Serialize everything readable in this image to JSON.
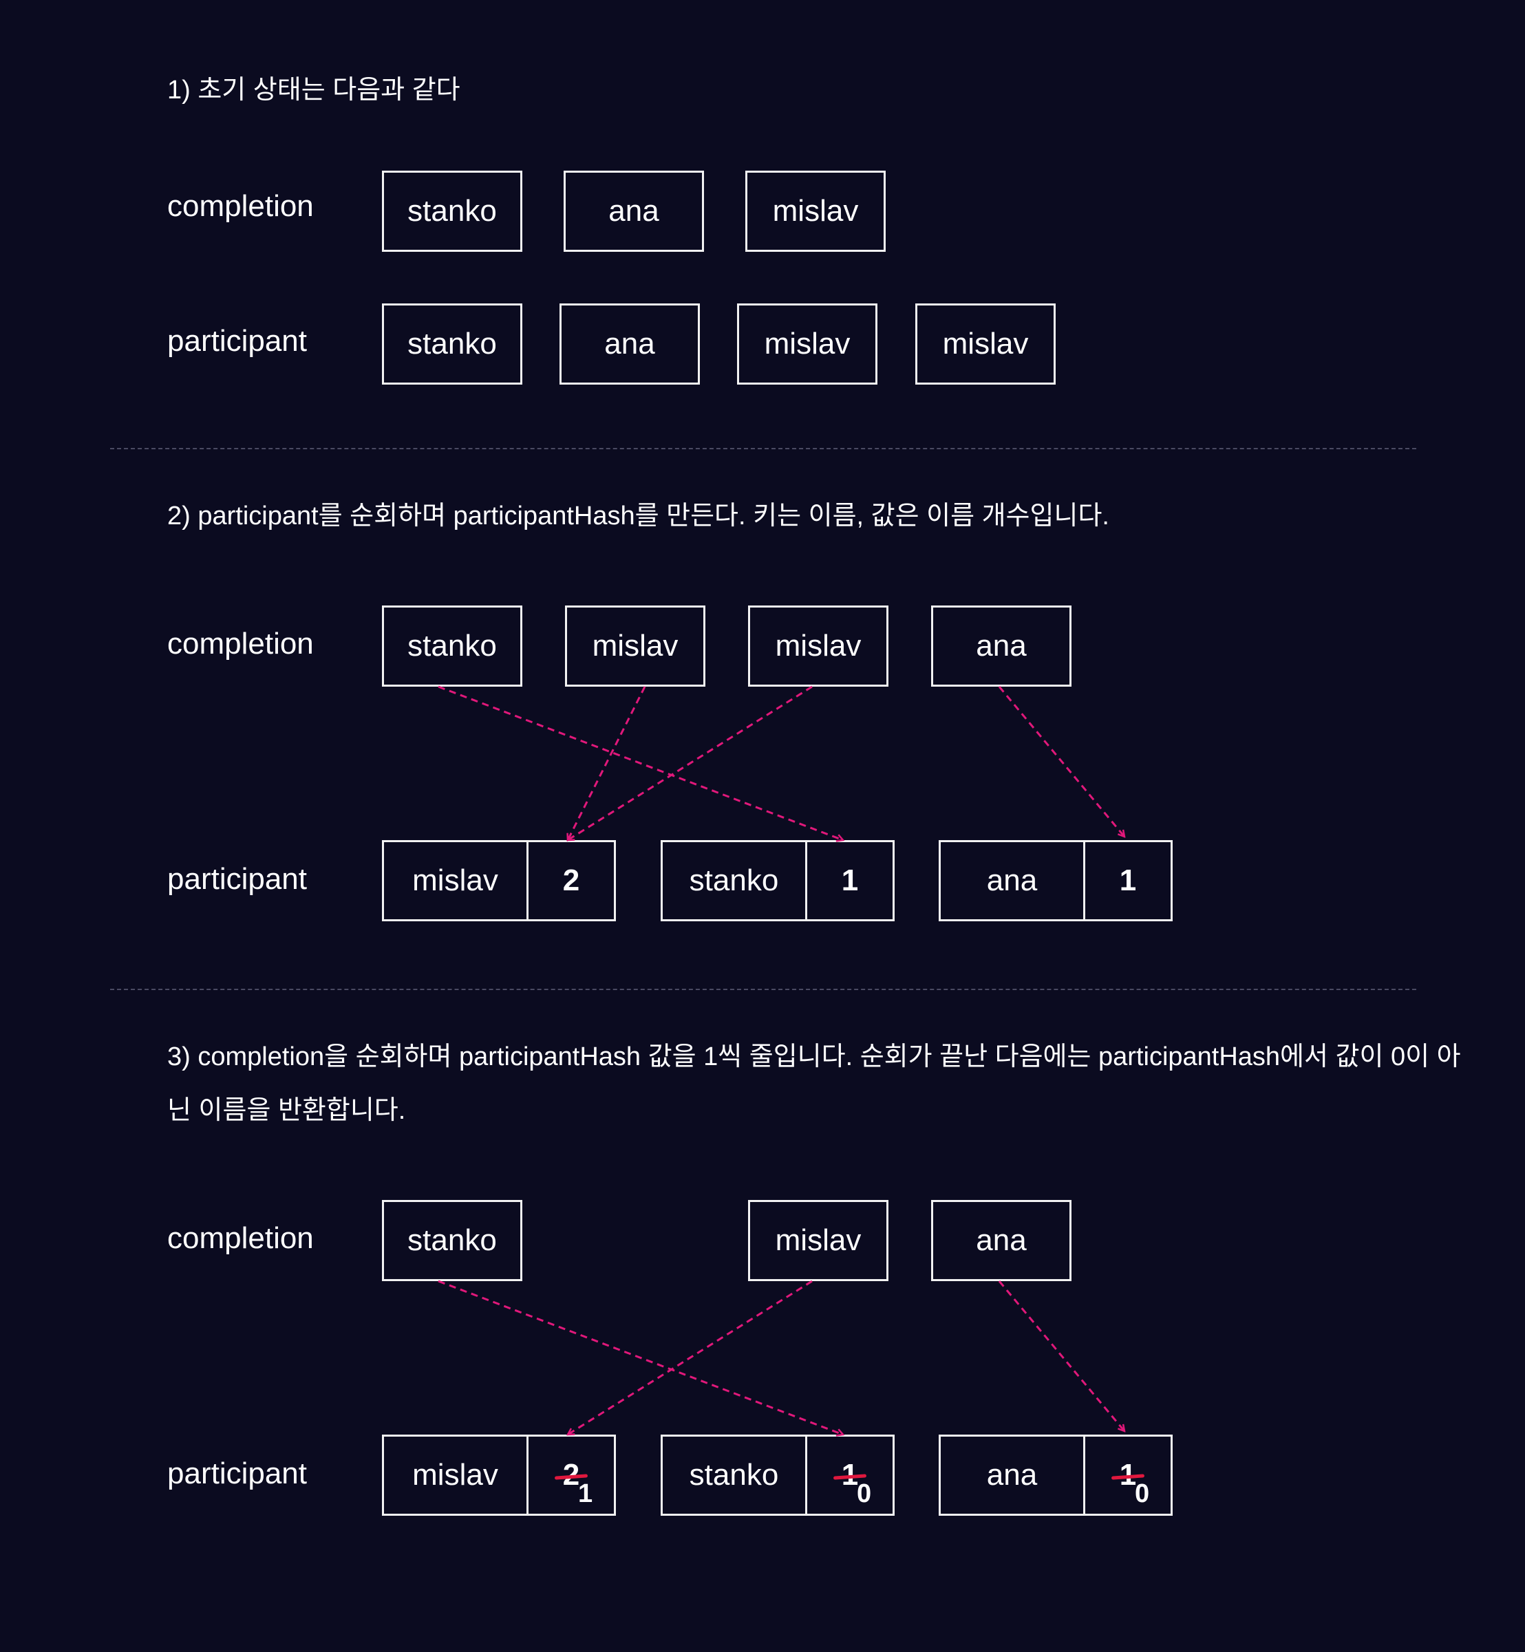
{
  "section1": {
    "heading": "1) 초기 상태는 다음과 같다",
    "completion_label": "completion",
    "participant_label": "participant",
    "completion": [
      "stanko",
      "ana",
      "mislav"
    ],
    "participant": [
      "stanko",
      "ana",
      "mislav",
      "mislav"
    ]
  },
  "section2": {
    "heading": "2) participant를 순회하며 participantHash를 만든다. 키는 이름, 값은 이름 개수입니다.",
    "completion_label": "completion",
    "participant_label": "participant",
    "completion": [
      "stanko",
      "mislav",
      "mislav",
      "ana"
    ],
    "hash": [
      {
        "key": "mislav",
        "value": "2"
      },
      {
        "key": "stanko",
        "value": "1"
      },
      {
        "key": "ana",
        "value": "1"
      }
    ]
  },
  "section3": {
    "heading": "3) completion을 순회하며 participantHash 값을 1씩 줄입니다. 순회가 끝난 다음에는 participantHash에서 값이 0이 아닌 이름을 반환합니다.",
    "completion_label": "completion",
    "participant_label": "participant",
    "completion": [
      "stanko",
      "mislav",
      "ana"
    ],
    "hash": [
      {
        "key": "mislav",
        "old": "2",
        "new": "1"
      },
      {
        "key": "stanko",
        "old": "1",
        "new": "0"
      },
      {
        "key": "ana",
        "old": "1",
        "new": "0"
      }
    ]
  },
  "colors": {
    "background": "#0b0b20",
    "arrow": "#e0187a",
    "strike": "#e0183e",
    "box_border": "#f2f2f2"
  }
}
